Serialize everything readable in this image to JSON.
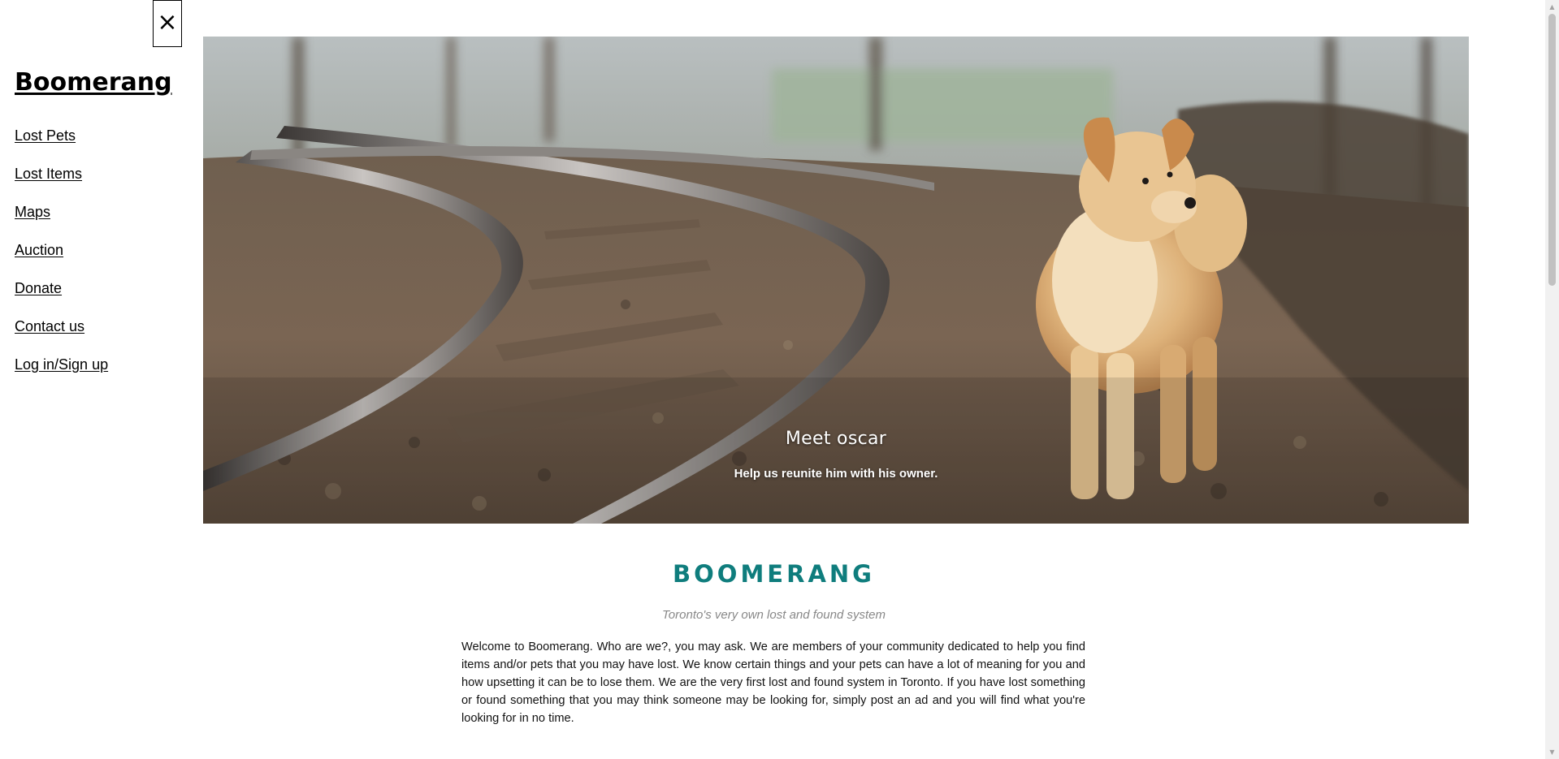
{
  "sidebar": {
    "close_symbol": "×",
    "brand": "Boomerang",
    "items": [
      {
        "label": "Lost Pets"
      },
      {
        "label": "Lost Items"
      },
      {
        "label": "Maps"
      },
      {
        "label": "Auction"
      },
      {
        "label": "Donate"
      },
      {
        "label": "Contact us"
      },
      {
        "label": "Log in/Sign up"
      }
    ]
  },
  "hero": {
    "title": "Meet oscar",
    "subtitle": "Help us reunite him with his owner."
  },
  "intro": {
    "title": "BOOMERANG",
    "tagline": "Toronto's very own lost and found system",
    "body": "Welcome to Boomerang. Who are we?, you may ask. We are members of your community dedicated to help you find items and/or pets that you may have lost. We know certain things and your pets can have a lot of meaning for you and how upsetting it can be to lose them. We are the very first lost and found system in Toronto. If you have lost something or found something that you may think someone may be looking for, simply post an ad and you will find what you're looking for in no time."
  },
  "colors": {
    "accent": "#0f7d7d",
    "tagline": "#888888"
  },
  "icons": {
    "close": "close-icon",
    "scroll_up": "scroll-up-icon",
    "scroll_down": "scroll-down-icon"
  }
}
